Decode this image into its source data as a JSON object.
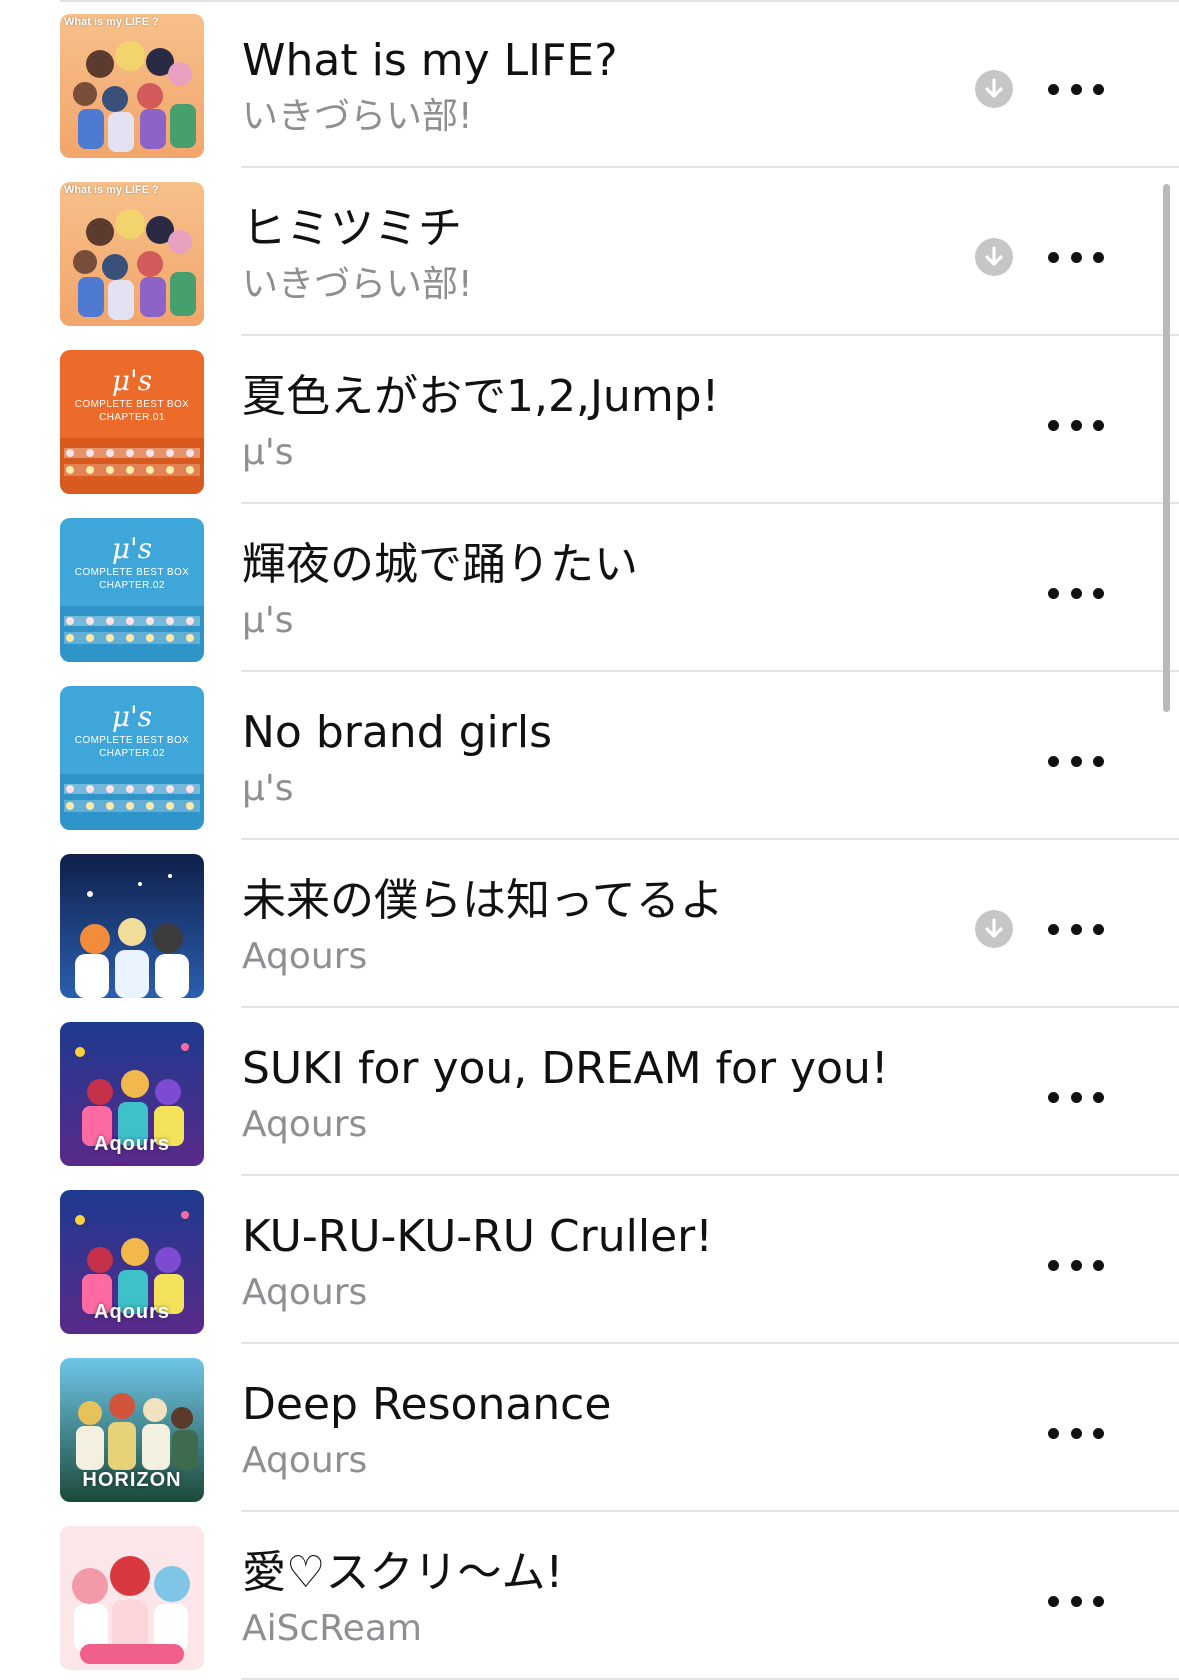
{
  "songs": [
    {
      "title": "What is my LIFE?",
      "artist": "いきづらい部!",
      "downloaded": true,
      "art": "wml",
      "art_text": "What is my LIFE ?"
    },
    {
      "title": "ヒミツミチ",
      "artist": "いきづらい部!",
      "downloaded": true,
      "art": "wml",
      "art_text": "What is my LIFE ?"
    },
    {
      "title": "夏色えがおで1,2,Jump!",
      "artist": "μ's",
      "downloaded": false,
      "art": "orange",
      "art_text": "COMPLETE BEST BOX CHAPTER.01",
      "art_logo": "μ's"
    },
    {
      "title": "輝夜の城で踊りたい",
      "artist": "μ's",
      "downloaded": false,
      "art": "blue",
      "art_text": "COMPLETE BEST BOX CHAPTER.02",
      "art_logo": "μ's"
    },
    {
      "title": "No brand girls",
      "artist": "μ's",
      "downloaded": false,
      "art": "blue",
      "art_text": "COMPLETE BEST BOX CHAPTER.02",
      "art_logo": "μ's"
    },
    {
      "title": "未来の僕らは知ってるよ",
      "artist": "Aqours",
      "downloaded": true,
      "art": "navy",
      "art_text": ""
    },
    {
      "title": "SUKI for you, DREAM for you!",
      "artist": "Aqours",
      "downloaded": false,
      "art": "cruller",
      "art_word": "Aqours"
    },
    {
      "title": "KU-RU-KU-RU Cruller!",
      "artist": "Aqours",
      "downloaded": false,
      "art": "cruller",
      "art_word": "Aqours"
    },
    {
      "title": "Deep Resonance",
      "artist": "Aqours",
      "downloaded": false,
      "art": "horizon",
      "art_word": "HORIZON"
    },
    {
      "title": "愛♡スクリ〜ム!",
      "artist": "AiScReam",
      "downloaded": false,
      "art": "pink",
      "art_text": ""
    }
  ],
  "colors": {
    "accent_text": "#111111",
    "secondary_text": "#8e8e93",
    "download_icon_bg": "#c6c6c8"
  },
  "icons": {
    "download": "arrow-down-circle-icon",
    "more": "ellipsis-icon"
  }
}
